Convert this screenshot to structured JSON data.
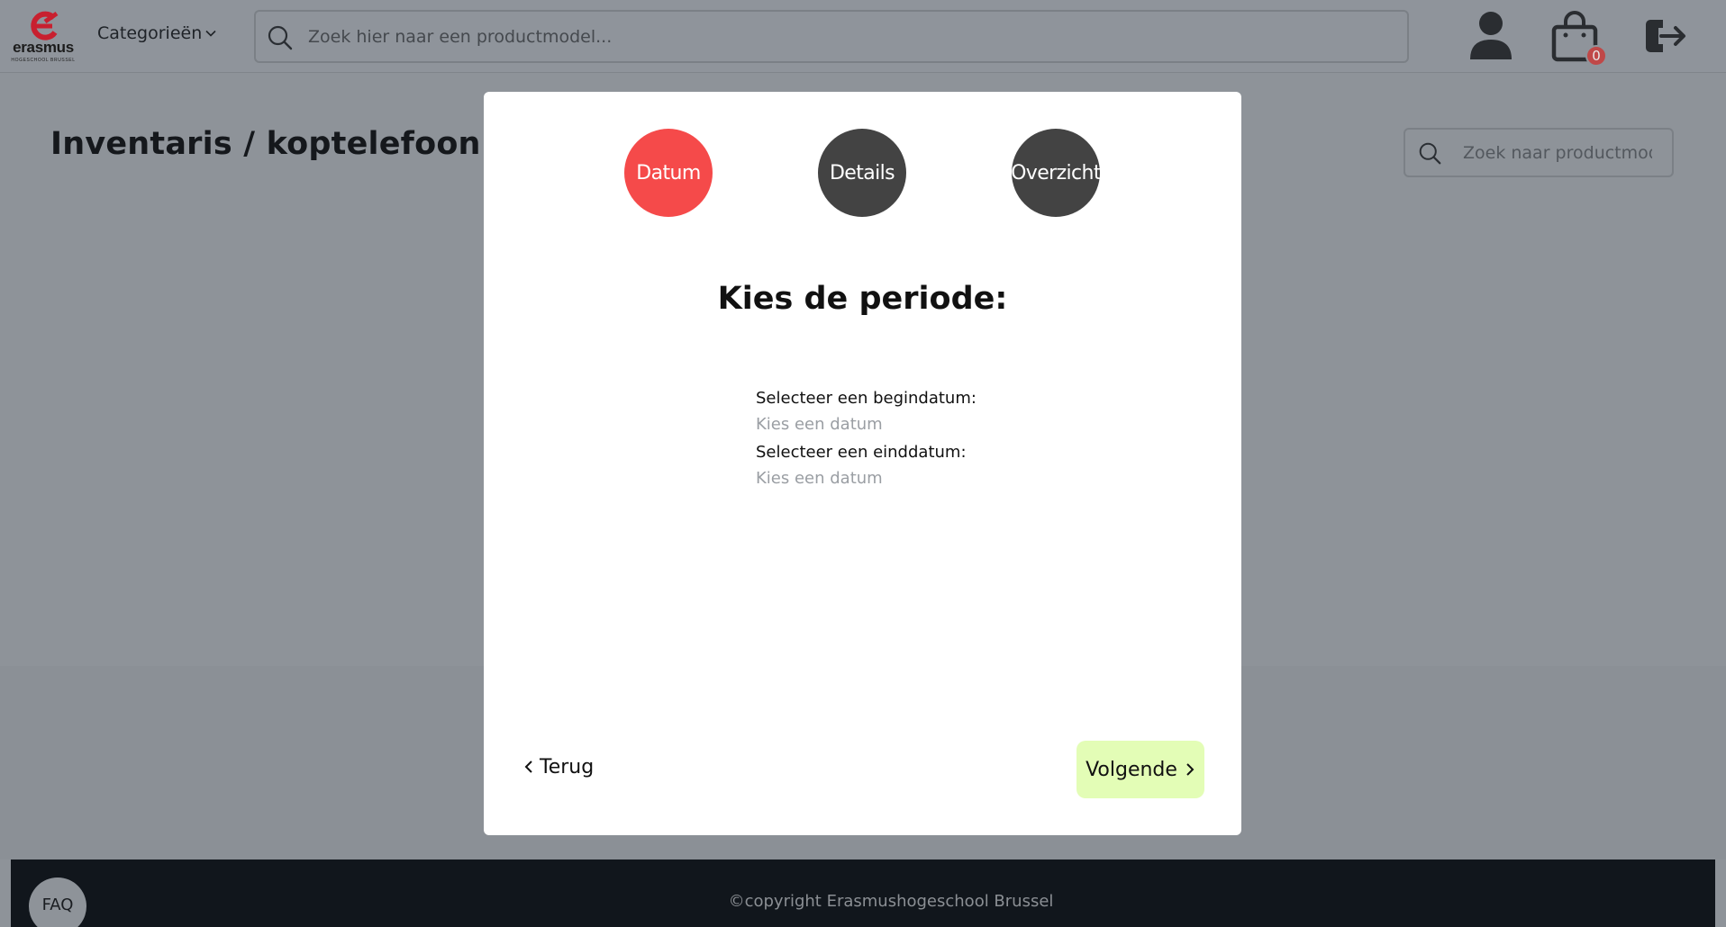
{
  "navbar": {
    "logo_word": "erasmus",
    "logo_sub": "HOGESCHOOL BRUSSEL",
    "categories_label": "Categorieën",
    "search_placeholder": "Zoek hier naar een productmodel...",
    "cart_count": "0"
  },
  "page": {
    "title": "Inventaris / koptelefoon",
    "side_search_placeholder": "Zoek naar productmodel"
  },
  "modal": {
    "steps": [
      {
        "label": "Datum",
        "active": true
      },
      {
        "label": "Details",
        "active": false
      },
      {
        "label": "Overzicht",
        "active": false
      }
    ],
    "title": "Kies de periode:",
    "start_label": "Selecteer een begindatum:",
    "start_placeholder": "Kies een datum",
    "end_label": "Selecteer een einddatum:",
    "end_placeholder": "Kies een datum",
    "back_label": "Terug",
    "next_label": "Volgende"
  },
  "footer": {
    "faq_label": "FAQ",
    "copyright": "©copyright Erasmushogeschool Brussel"
  },
  "colors": {
    "active_step": "#f54a4a",
    "inactive_step": "#434343",
    "next_button": "#e3fdb6",
    "cart_badge": "#c04848",
    "logo_red": "#c8202f"
  },
  "icons": [
    "search-icon",
    "chevron-down-icon",
    "user-icon",
    "shopping-bag-icon",
    "logout-icon",
    "chevron-left-icon",
    "chevron-right-icon"
  ]
}
